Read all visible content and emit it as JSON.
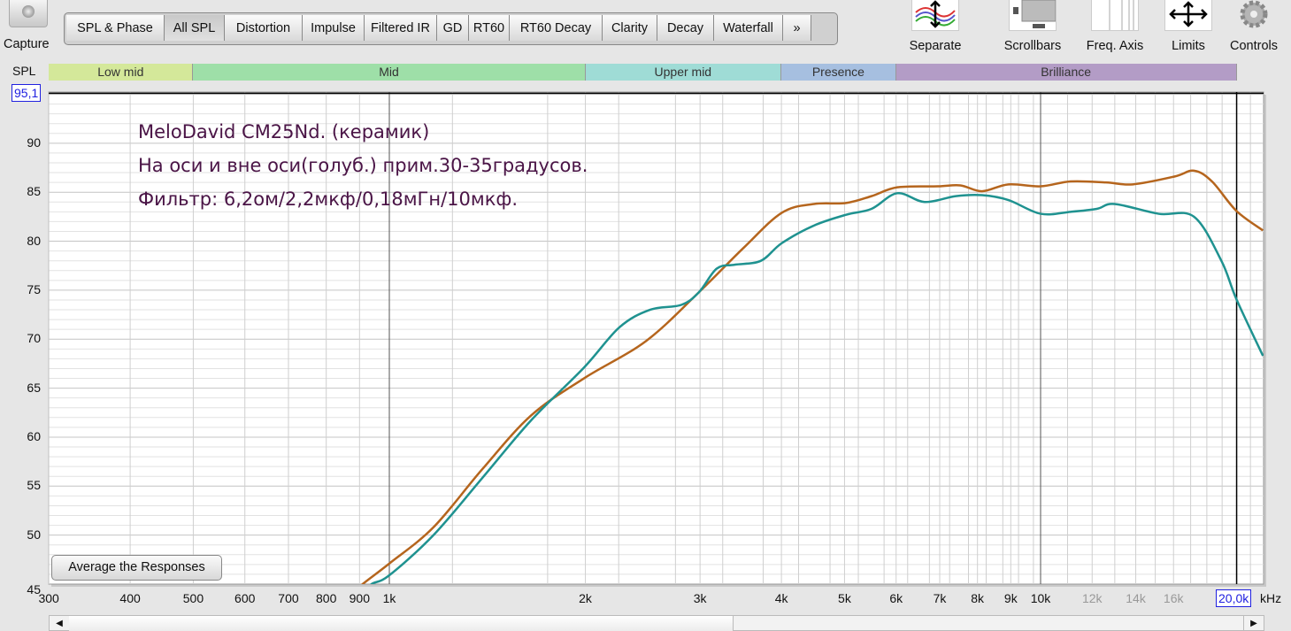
{
  "toolbar": {
    "capture_label": "Capture",
    "tabs": [
      "SPL & Phase",
      "All SPL",
      "Distortion",
      "Impulse",
      "Filtered IR",
      "GD",
      "RT60",
      "RT60 Decay",
      "Clarity",
      "Decay",
      "Waterfall",
      "»"
    ],
    "active_tab": "All SPL",
    "tools": [
      {
        "label": "Separate",
        "icon": "separate-traces-icon"
      },
      {
        "label": "Scrollbars",
        "icon": "scrollbars-icon"
      },
      {
        "label": "Freq. Axis",
        "icon": "freq-axis-icon"
      },
      {
        "label": "Limits",
        "icon": "limits-arrows-icon"
      },
      {
        "label": "Controls",
        "icon": "gear-icon"
      }
    ]
  },
  "bands": [
    {
      "label": "Low mid",
      "from": 300,
      "to": 500,
      "color": "#d4e89a"
    },
    {
      "label": "Mid",
      "from": 500,
      "to": 2000,
      "color": "#9edfa8"
    },
    {
      "label": "Upper mid",
      "from": 2000,
      "to": 4000,
      "color": "#9fdcd6"
    },
    {
      "label": "Presence",
      "from": 4000,
      "to": 6000,
      "color": "#a6bfe0"
    },
    {
      "label": "Brilliance",
      "from": 6000,
      "to": 20000,
      "color": "#b39cc6"
    }
  ],
  "annotation": [
    "MeloDavid CM25Nd. (керамик)",
    "На оси и вне оси(голуб.) прим.30-35градусов.",
    "Фильтр: 6,2ом/2,2мкф/0,18мГн/10мкф."
  ],
  "average_button": "Average the Responses",
  "cursor": {
    "spl_label": "95,1",
    "freq_label": "20,0k",
    "spl": 95.1,
    "freq": 20000
  },
  "chart_data": {
    "type": "line",
    "ylabel": "SPL",
    "xunit": "kHz",
    "xscale": "log",
    "xlim": [
      300,
      22000
    ],
    "ylim": [
      45,
      95.1
    ],
    "grid": true,
    "yticks": [
      45,
      50,
      55,
      60,
      65,
      70,
      75,
      80,
      85,
      90
    ],
    "xticks": [
      {
        "v": 300,
        "label": "300"
      },
      {
        "v": 400,
        "label": "400"
      },
      {
        "v": 500,
        "label": "500"
      },
      {
        "v": 600,
        "label": "600"
      },
      {
        "v": 700,
        "label": "700"
      },
      {
        "v": 800,
        "label": "800"
      },
      {
        "v": 900,
        "label": "900"
      },
      {
        "v": 1000,
        "label": "1k"
      },
      {
        "v": 2000,
        "label": "2k"
      },
      {
        "v": 3000,
        "label": "3k"
      },
      {
        "v": 4000,
        "label": "4k"
      },
      {
        "v": 5000,
        "label": "5k"
      },
      {
        "v": 6000,
        "label": "6k"
      },
      {
        "v": 7000,
        "label": "7k"
      },
      {
        "v": 8000,
        "label": "8k"
      },
      {
        "v": 9000,
        "label": "9k"
      },
      {
        "v": 10000,
        "label": "10k"
      },
      {
        "v": 12000,
        "label": "12k",
        "dim": true
      },
      {
        "v": 14000,
        "label": "14k",
        "dim": true
      },
      {
        "v": 16000,
        "label": "16k",
        "dim": true
      }
    ],
    "series": [
      {
        "color": "#b5651d",
        "x": [
          880,
          910,
          1000,
          1169,
          1388,
          1650,
          1990,
          2477,
          2989,
          3496,
          4005,
          4488,
          5027,
          5500,
          6026,
          6955,
          7530,
          8130,
          8925,
          10000,
          11120,
          12600,
          13850,
          16050,
          17200,
          18330,
          19980,
          21950
        ],
        "y": [
          44,
          45,
          47.1,
          50.8,
          56.7,
          62.2,
          66,
          69.8,
          74.8,
          79.3,
          82.9,
          83.8,
          83.9,
          84.6,
          85.5,
          85.6,
          85.7,
          85.1,
          85.8,
          85.6,
          86.1,
          86,
          85.8,
          86.6,
          87.2,
          86.1,
          83.1,
          81.1
        ]
      },
      {
        "color": "#1f9290",
        "x": [
          910,
          939,
          1000,
          1169,
          1388,
          1650,
          1990,
          2255,
          2513,
          2807,
          2989,
          3182,
          3389,
          3720,
          4005,
          4488,
          5027,
          5500,
          6026,
          6634,
          7410,
          8130,
          8925,
          10000,
          11120,
          12200,
          12990,
          15180,
          17200,
          18950,
          19980,
          21950
        ],
        "y": [
          44,
          45,
          45.9,
          50,
          55.8,
          61.7,
          67.1,
          71.2,
          73,
          73.5,
          74.8,
          77.2,
          77.6,
          78,
          79.8,
          81.6,
          82.7,
          83.3,
          84.9,
          84,
          84.6,
          84.7,
          84.2,
          82.8,
          83,
          83.3,
          83.8,
          82.8,
          82.5,
          78,
          74.1,
          68.3
        ]
      }
    ]
  }
}
